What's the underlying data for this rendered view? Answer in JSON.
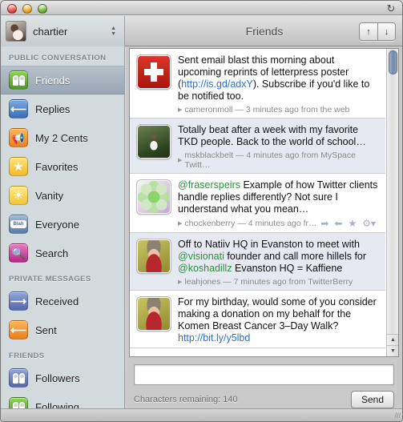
{
  "window": {
    "title": "Friends",
    "traffic_lights": [
      "close",
      "minimize",
      "zoom"
    ],
    "refresh_icon": "refresh-icon",
    "resize_grip": "///"
  },
  "toolbar": {
    "account_name": "chartier",
    "account_avatar": "user-avatar",
    "stepper_up": "▲",
    "stepper_down": "▼",
    "nav_prev_label": "↑",
    "nav_next_label": "↓",
    "refresh_glyph": "↻"
  },
  "sidebar": {
    "sections": [
      {
        "header": "PUBLIC CONVERSATION",
        "items": [
          {
            "label": "Friends",
            "icon": "people-icon",
            "color": "green",
            "selected": true
          },
          {
            "label": "Replies",
            "icon": "reply-arrow-icon",
            "color": "blue",
            "selected": false
          },
          {
            "label": "My 2 Cents",
            "icon": "megaphone-icon",
            "color": "orange",
            "selected": false
          },
          {
            "label": "Favorites",
            "icon": "star-icon",
            "color": "yellow",
            "selected": false
          },
          {
            "label": "Vanity",
            "icon": "sun-icon",
            "color": "gold",
            "selected": false
          },
          {
            "label": "Everyone",
            "icon": "speech-bubble-icon",
            "color": "steel",
            "selected": false
          },
          {
            "label": "Search",
            "icon": "search-icon",
            "color": "pink",
            "selected": false
          }
        ]
      },
      {
        "header": "PRIVATE MESSAGES",
        "items": [
          {
            "label": "Received",
            "icon": "arrow-right-icon",
            "color": "indigo",
            "selected": false
          },
          {
            "label": "Sent",
            "icon": "arrow-left-icon",
            "color": "orange",
            "selected": false
          }
        ]
      },
      {
        "header": "FRIENDS",
        "items": [
          {
            "label": "Followers",
            "icon": "people-icon",
            "color": "indigo",
            "selected": false
          },
          {
            "label": "Following",
            "icon": "people-icon",
            "color": "green",
            "selected": false
          }
        ]
      }
    ]
  },
  "timeline": {
    "tweets": [
      {
        "avatar": "swiss-cross-avatar",
        "text_before": "Sent email blast this morning about upcoming reprints of letterpress poster (",
        "link": "http://is.gd/adxY",
        "text_after": "). Subscribe if you'd like to be notified too.",
        "username": "cameronmoll",
        "meta": "cameronmoll — 3 minutes ago from the web",
        "alt_row": false,
        "show_actions": false
      },
      {
        "avatar": "tkd-photo-avatar",
        "text_before": "Totally beat after a week with my favorite TKD people. Back to the world of school…",
        "link": "",
        "text_after": "",
        "username": "mskblackbelt",
        "meta": "mskblackbelt — 4 minutes ago from MySpace Twitt…",
        "alt_row": true,
        "show_actions": false
      },
      {
        "avatar": "green-flower-avatar",
        "mention": "@fraserspeirs",
        "text_before": " Example of how Twitter clients handle replies differently? Not sure I understand what you mean…",
        "link": "",
        "text_after": "",
        "username": "chockenberry",
        "meta": "chockenberry — 4 minutes ago fr…",
        "alt_row": false,
        "show_actions": true,
        "actions": [
          {
            "name": "retweet-icon",
            "glyph": "➡"
          },
          {
            "name": "reply-icon",
            "glyph": "⬅"
          },
          {
            "name": "favorite-icon",
            "glyph": "★"
          },
          {
            "name": "gear-menu-icon",
            "glyph": "⚙▾"
          }
        ]
      },
      {
        "avatar": "leahjones-photo-avatar",
        "text_before": "Off to Natiiv HQ in Evanston to meet with ",
        "mention1": "@visionati",
        "text_mid": " founder and call more hillels for ",
        "mention2": "@koshadillz",
        "text_after": " Evanston HQ = Kaffiene",
        "username": "leahjones",
        "meta": "leahjones — 7 minutes ago from TwitterBerry",
        "alt_row": true,
        "show_actions": false
      },
      {
        "avatar": "leahjones-photo-avatar",
        "text_before": "For my birthday, would some of you consider making a donation on my behalf for the Komen Breast Cancer 3–Day Walk? ",
        "link": "http://bit.ly/y5lbd",
        "text_after": "",
        "username": "",
        "meta": "",
        "alt_row": false,
        "show_actions": false
      }
    ],
    "scrollbar": {
      "up_glyph": "▲",
      "down_glyph": "▼"
    }
  },
  "compose": {
    "input_value": "",
    "input_placeholder": "",
    "characters_remaining": "Characters remaining: 140",
    "send_label": "Send"
  }
}
